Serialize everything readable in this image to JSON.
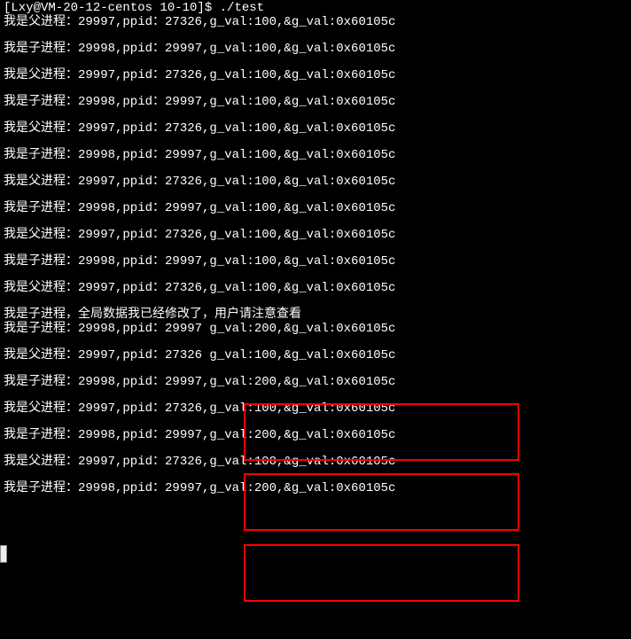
{
  "prompt": "[Lxy@VM-20-12-centos 10-10]$ ./test",
  "lines": [
    {
      "role": "parent",
      "pid": "29997",
      "ppid": "27326",
      "gval": "100",
      "addr": "0x60105c"
    },
    {
      "blank": true
    },
    {
      "role": "child",
      "pid": "29998",
      "ppid": "29997",
      "gval": "100",
      "addr": "0x60105c"
    },
    {
      "blank": true
    },
    {
      "role": "parent",
      "pid": "29997",
      "ppid": "27326",
      "gval": "100",
      "addr": "0x60105c"
    },
    {
      "blank": true
    },
    {
      "role": "child",
      "pid": "29998",
      "ppid": "29997",
      "gval": "100",
      "addr": "0x60105c"
    },
    {
      "blank": true
    },
    {
      "role": "parent",
      "pid": "29997",
      "ppid": "27326",
      "gval": "100",
      "addr": "0x60105c"
    },
    {
      "blank": true
    },
    {
      "role": "child",
      "pid": "29998",
      "ppid": "29997",
      "gval": "100",
      "addr": "0x60105c"
    },
    {
      "blank": true
    },
    {
      "role": "parent",
      "pid": "29997",
      "ppid": "27326",
      "gval": "100",
      "addr": "0x60105c"
    },
    {
      "blank": true
    },
    {
      "role": "child",
      "pid": "29998",
      "ppid": "29997",
      "gval": "100",
      "addr": "0x60105c"
    },
    {
      "blank": true
    },
    {
      "role": "parent",
      "pid": "29997",
      "ppid": "27326",
      "gval": "100",
      "addr": "0x60105c"
    },
    {
      "blank": true
    },
    {
      "role": "child",
      "pid": "29998",
      "ppid": "29997",
      "gval": "100",
      "addr": "0x60105c"
    },
    {
      "blank": true
    },
    {
      "role": "parent",
      "pid": "29997",
      "ppid": "27326",
      "gval": "100",
      "addr": "0x60105c"
    },
    {
      "blank": true
    },
    {
      "raw": "我是子进程，全局数据我已经修改了，用户请注意查看"
    },
    {
      "role": "child",
      "pid": "29998",
      "ppid": "29997",
      "gval": "200",
      "addr": "0x60105c",
      "sep": " "
    },
    {
      "blank": true
    },
    {
      "role": "parent",
      "pid": "29997",
      "ppid": "27326",
      "gval": "100",
      "addr": "0x60105c",
      "sep": " "
    },
    {
      "blank": true
    },
    {
      "role": "child",
      "pid": "29998",
      "ppid": "29997",
      "gval": "200",
      "addr": "0x60105c"
    },
    {
      "blank": true
    },
    {
      "role": "parent",
      "pid": "29997",
      "ppid": "27326",
      "gval": "100",
      "addr": "0x60105c"
    },
    {
      "blank": true
    },
    {
      "role": "child",
      "pid": "29998",
      "ppid": "29997",
      "gval": "200",
      "addr": "0x60105c"
    },
    {
      "blank": true
    },
    {
      "role": "parent",
      "pid": "29997",
      "ppid": "27326",
      "gval": "100",
      "addr": "0x60105c"
    },
    {
      "blank": true
    },
    {
      "role": "child",
      "pid": "29998",
      "ppid": "29997",
      "gval": "200",
      "addr": "0x60105c"
    }
  ],
  "labels": {
    "parent": "我是父进程：",
    "child": "我是子进程：",
    "ppid": ",ppid：",
    "gval_prefix": ",g_val:",
    "addr_prefix": ",&g_val:"
  }
}
